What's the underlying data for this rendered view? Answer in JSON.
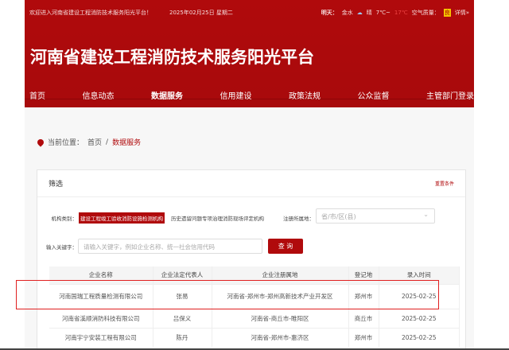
{
  "topbar": {
    "welcome": "欢迎进入河南省建设工程消防技术服务阳光平台！",
    "date": "2025年02月25日 星期二",
    "tomorrow": "明天：",
    "city": "金水",
    "weather": "晴",
    "temp1": "7℃~",
    "temp2": "17℃",
    "air": "空气质量：",
    "aqi": "良",
    "detail": "详情»"
  },
  "site_title": "河南省建设工程消防技术服务阳光平台",
  "nav": [
    "首页",
    "信息动态",
    "数据服务",
    "信用建设",
    "政策法规",
    "公众监督",
    "主管部门登录"
  ],
  "breadcrumb": {
    "label": "当前位置：",
    "home": "首页",
    "sep": "/",
    "current": "数据服务"
  },
  "filter": {
    "title": "筛选",
    "reset": "重置条件",
    "type_label": "机构类别：",
    "type_selected": "建设工程竣工验收消防设施检测机构",
    "type_other": "历史遗留问题专项治理消防现场评定机构",
    "region_label": "注册所属地：",
    "region_placeholder": "省/市/区(县)",
    "keyword_label": "输入关键字：",
    "keyword_placeholder": "请输入关键字，例如企业名称、统一社会信用代码",
    "search": "查 询"
  },
  "table": {
    "headers": [
      "企业名称",
      "企业法定代表人",
      "企业注册属地",
      "登记地",
      "录入时间"
    ],
    "rows": [
      [
        "河南国瑞工程质量检测有限公司",
        "张易",
        "河南省-郑州市-郑州高新技术产业开发区",
        "郑州市",
        "2025-02-25"
      ],
      [
        "河南省溪顺消防科技有限公司",
        "吕保义",
        "河南省-商丘市-睢阳区",
        "商丘市",
        "2025-02-25"
      ],
      [
        "河南宇宁安装工程有限公司",
        "陈丹",
        "河南省-郑州市-惠济区",
        "郑州市",
        "2025-02-25"
      ]
    ]
  }
}
